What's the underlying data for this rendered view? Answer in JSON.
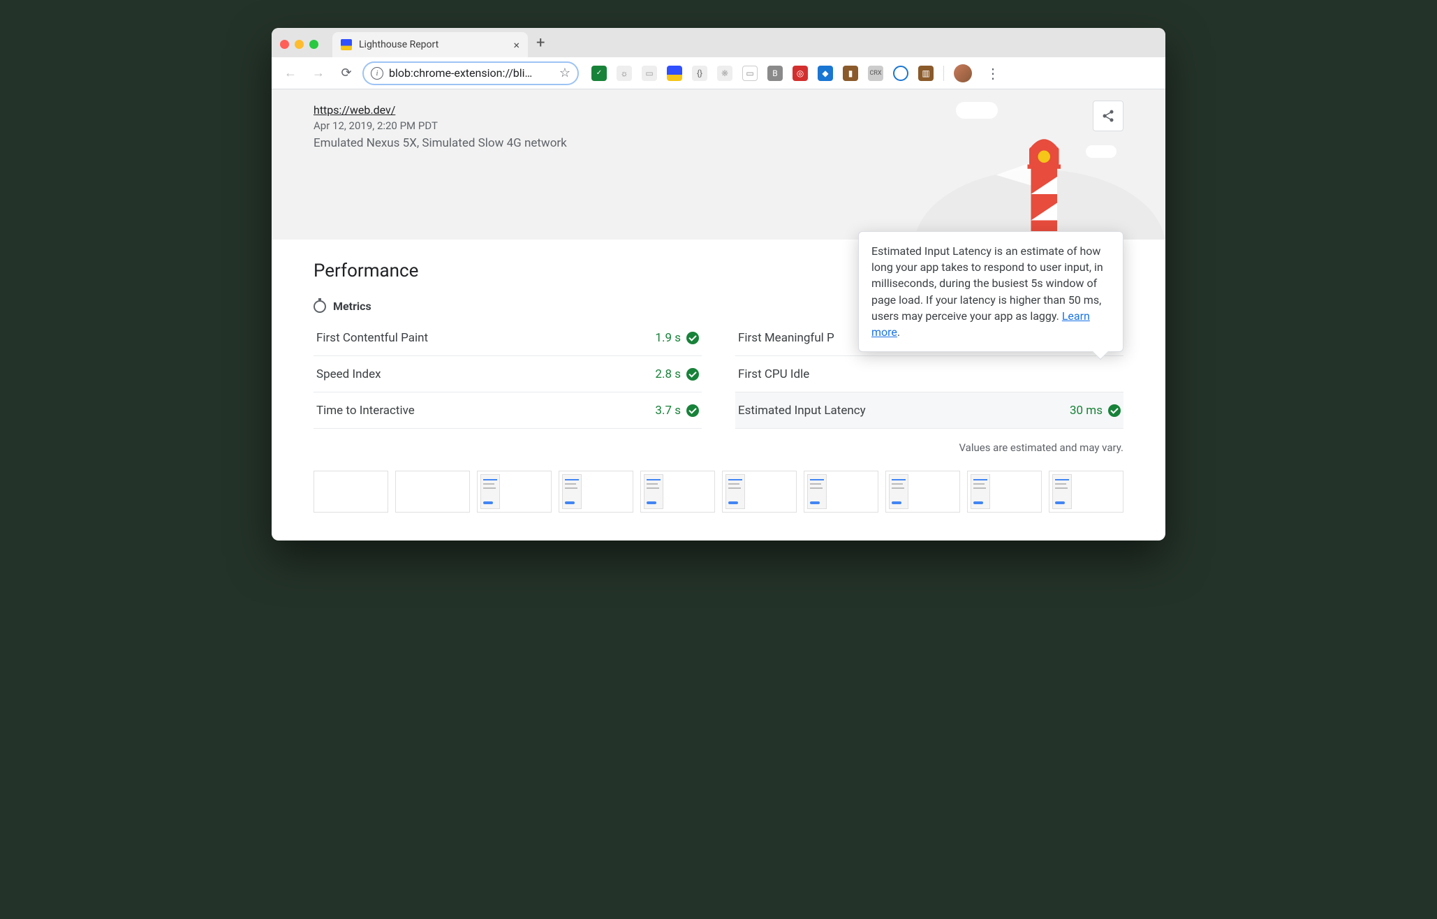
{
  "browser": {
    "tab_title": "Lighthouse Report",
    "omnibox": "blob:chrome-extension://bli…"
  },
  "header": {
    "url": "https://web.dev/",
    "timestamp": "Apr 12, 2019, 2:20 PM PDT",
    "environment": "Emulated Nexus 5X, Simulated Slow 4G network"
  },
  "section": {
    "title": "Performance",
    "metrics_label": "Metrics"
  },
  "metrics": {
    "left": [
      {
        "name": "First Contentful Paint",
        "value": "1.9 s"
      },
      {
        "name": "Speed Index",
        "value": "2.8 s"
      },
      {
        "name": "Time to Interactive",
        "value": "3.7 s"
      }
    ],
    "right": [
      {
        "name": "First Meaningful P",
        "value": ""
      },
      {
        "name": "First CPU Idle",
        "value": ""
      },
      {
        "name": "Estimated Input Latency",
        "value": "30 ms"
      }
    ]
  },
  "tooltip": {
    "text": "Estimated Input Latency is an estimate of how long your app takes to respond to user input, in milliseconds, during the busiest 5s window of page load. If your latency is higher than 50 ms, users may perceive your app as laggy. ",
    "link": "Learn more"
  },
  "footnote": "Values are estimated and may vary.",
  "filmstrip_frames": 10,
  "filmstrip_content_from": 2
}
